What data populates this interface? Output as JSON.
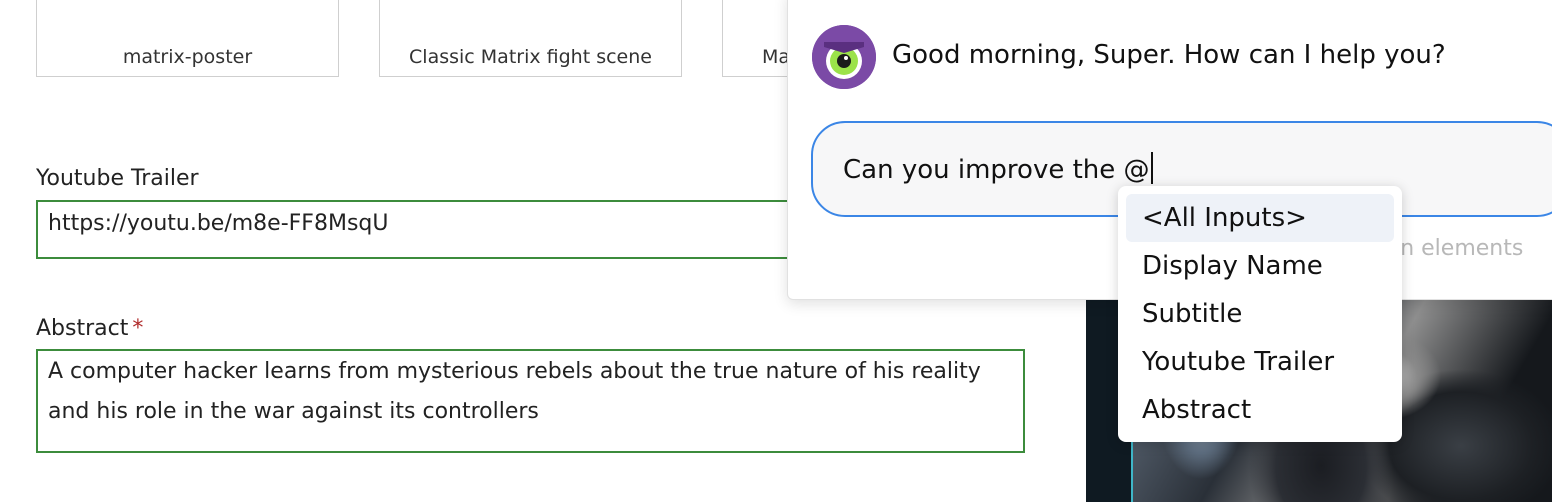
{
  "thumbnails": [
    {
      "caption": "matrix-poster"
    },
    {
      "caption": "Classic Matrix fight scene"
    },
    {
      "caption": "Ma"
    }
  ],
  "form": {
    "youtube_trailer": {
      "label": "Youtube Trailer",
      "value": "https://youtu.be/m8e-FF8MsqU"
    },
    "abstract": {
      "label": "Abstract",
      "required_mark": "*",
      "value": "A computer hacker learns from mysterious rebels about the true nature of his reality and his role in the war against its controllers"
    }
  },
  "assistant": {
    "greeting": "Good morning, Super. How can I help you?",
    "prompt_value": "Can you improve the @",
    "hint_fragment": "tion elements",
    "mention_options": [
      "<All Inputs>",
      "Display Name",
      "Subtitle",
      "Youtube Trailer",
      "Abstract"
    ],
    "active_option_index": 0,
    "accent_color": "#3b86e6",
    "avatar_color": "#7b4aa6"
  }
}
